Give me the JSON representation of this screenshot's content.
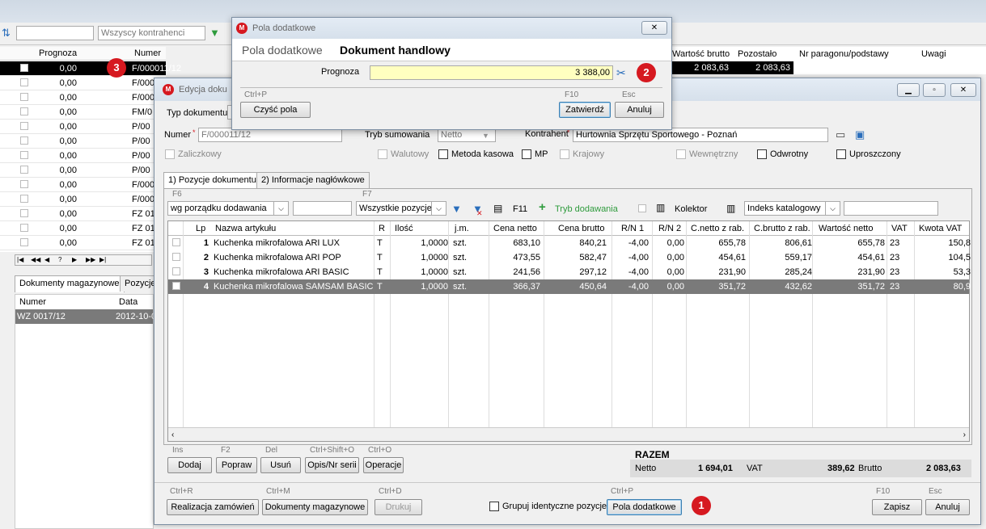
{
  "bg": {
    "filter": {
      "search_value": "",
      "contractors": "Wszyscy kontrahenci"
    },
    "grid": {
      "headers": {
        "prognoza": "Prognoza",
        "numer": "Numer"
      },
      "rows": [
        {
          "p": "0,00",
          "n": "F/000011/12"
        },
        {
          "p": "0,00",
          "n": "F/000"
        },
        {
          "p": "0,00",
          "n": "F/000"
        },
        {
          "p": "0,00",
          "n": "FM/0"
        },
        {
          "p": "0,00",
          "n": "P/00"
        },
        {
          "p": "0,00",
          "n": "P/00"
        },
        {
          "p": "0,00",
          "n": "P/00"
        },
        {
          "p": "0,00",
          "n": "P/00"
        },
        {
          "p": "0,00",
          "n": "F/000"
        },
        {
          "p": "0,00",
          "n": "F/000"
        },
        {
          "p": "0,00",
          "n": "FZ 01"
        },
        {
          "p": "0,00",
          "n": "FZ 01"
        },
        {
          "p": "0,00",
          "n": "FZ 01"
        }
      ],
      "nav": [
        "|◀",
        "◀◀",
        "◀",
        "?",
        "▶",
        "▶▶",
        "▶|"
      ],
      "right_headers": {
        "brutto": "Wartość brutto",
        "pozostalo": "Pozostało",
        "paragon": "Nr paragonu/podstawy",
        "uwagi": "Uwagi"
      },
      "right_row": {
        "brutto": "2 083,63",
        "pozostalo": "2 083,63"
      }
    },
    "lower_tabs": [
      "Dokumenty magazynowe",
      "Pozycje"
    ],
    "lower_grid": {
      "headers": {
        "numer": "Numer",
        "data": "Data"
      },
      "row": {
        "numer": "WZ 0017/12",
        "data": "2012-10-0"
      }
    }
  },
  "dialog": {
    "title": "Edycja doku",
    "typ_label": "Typ dokumentu",
    "numer_label": "Numer",
    "numer_value": "F/000011/12",
    "tryb_label": "Tryb sumowania",
    "tryb_value": "Netto",
    "kontrahent_label": "Kontrahent",
    "kontrahent_value": "Hurtownia Sprzętu Sportowego - Poznań",
    "checks": {
      "zaliczkowy": "Zaliczkowy",
      "walutowy": "Walutowy",
      "metoda": "Metoda kasowa",
      "mp": "MP",
      "krajowy": "Krajowy",
      "wewnetrzny": "Wewnętrzny",
      "odwrotny": "Odwrotny",
      "uproszczony": "Uproszczony"
    },
    "tabs": [
      "1) Pozycje dokumentu",
      "2) Informacje nagłówkowe"
    ],
    "toolbar": {
      "f6": "F6",
      "sort": "wg porządku dodawania",
      "f7": "F7",
      "filter": "Wszystkie pozycje",
      "f11": "F11",
      "tryb": "Tryb dodawania",
      "kolektor": "Kolektor",
      "indeks": "Indeks katalogowy"
    },
    "grid": {
      "headers": {
        "lp": "Lp",
        "nazwa": "Nazwa artykułu",
        "r": "R",
        "ilosc": "Ilość",
        "jm": "j.m.",
        "cn": "Cena netto",
        "cb": "Cena brutto",
        "rn1": "R/N 1",
        "rn2": "R/N 2",
        "cnr": "C.netto z rab.",
        "cbr": "C.brutto z rab.",
        "wn": "Wartość netto",
        "vat": "VAT",
        "kv": "Kwota VAT"
      },
      "rows": [
        {
          "lp": "1",
          "nazwa": "Kuchenka mikrofalowa ARI LUX",
          "r": "T",
          "ilosc": "1,0000",
          "jm": "szt.",
          "cn": "683,10",
          "cb": "840,21",
          "rn1": "-4,00",
          "rn2": "0,00",
          "cnr": "655,78",
          "cbr": "806,61",
          "wn": "655,78",
          "vat": "23",
          "kv": "150,8"
        },
        {
          "lp": "2",
          "nazwa": "Kuchenka mikrofalowa ARI POP",
          "r": "T",
          "ilosc": "1,0000",
          "jm": "szt.",
          "cn": "473,55",
          "cb": "582,47",
          "rn1": "-4,00",
          "rn2": "0,00",
          "cnr": "454,61",
          "cbr": "559,17",
          "wn": "454,61",
          "vat": "23",
          "kv": "104,5"
        },
        {
          "lp": "3",
          "nazwa": "Kuchenka mikrofalowa ARI BASIC",
          "r": "T",
          "ilosc": "1,0000",
          "jm": "szt.",
          "cn": "241,56",
          "cb": "297,12",
          "rn1": "-4,00",
          "rn2": "0,00",
          "cnr": "231,90",
          "cbr": "285,24",
          "wn": "231,90",
          "vat": "23",
          "kv": "53,3"
        },
        {
          "lp": "4",
          "nazwa": "Kuchenka mikrofalowa SAMSAM BASIC",
          "r": "T",
          "ilosc": "1,0000",
          "jm": "szt.",
          "cn": "366,37",
          "cb": "450,64",
          "rn1": "-4,00",
          "rn2": "0,00",
          "cnr": "351,72",
          "cbr": "432,62",
          "wn": "351,72",
          "vat": "23",
          "kv": "80,9"
        }
      ]
    },
    "actions": [
      {
        "hint": "Ins",
        "label": "Dodaj"
      },
      {
        "hint": "F2",
        "label": "Popraw"
      },
      {
        "hint": "Del",
        "label": "Usuń"
      },
      {
        "hint": "Ctrl+Shift+O",
        "label": "Opis/Nr serii"
      },
      {
        "hint": "Ctrl+O",
        "label": "Operacje"
      }
    ],
    "razem": {
      "title": "RAZEM",
      "netto_label": "Netto",
      "netto": "1 694,01",
      "vat_label": "VAT",
      "vat": "389,62",
      "brutto_label": "Brutto",
      "brutto": "2 083,63"
    },
    "bottom": {
      "realizacja": {
        "hint": "Ctrl+R",
        "label": "Realizacja zamówień"
      },
      "dokumenty": {
        "hint": "Ctrl+M",
        "label": "Dokumenty magazynowe"
      },
      "drukuj": {
        "hint": "Ctrl+D",
        "label": "Drukuj"
      },
      "grupuj": "Grupuj identyczne pozycje",
      "pola": {
        "hint": "Ctrl+P",
        "label": "Pola dodatkowe"
      },
      "zapisz": {
        "hint": "F10",
        "label": "Zapisz"
      },
      "anuluj": {
        "hint": "Esc",
        "label": "Anuluj"
      }
    }
  },
  "popup": {
    "title": "Pola dodatkowe",
    "heading_left": "Pola dodatkowe",
    "heading_right": "Dokument handlowy",
    "prognoza_label": "Prognoza",
    "prognoza_value": "3 388,00",
    "clear": {
      "hint": "Ctrl+P",
      "label": "Czyść pola"
    },
    "confirm": {
      "hint": "F10",
      "label": "Zatwierdź"
    },
    "cancel": {
      "hint": "Esc",
      "label": "Anuluj"
    }
  },
  "badges": [
    "1",
    "2",
    "3"
  ],
  "colors": {
    "badge": "#d61920",
    "highlight_input": "#ffffc0",
    "selected_row": "#7a7a7a",
    "accent_green": "#2e9b3c",
    "accent_blue": "#2a6ebb"
  }
}
